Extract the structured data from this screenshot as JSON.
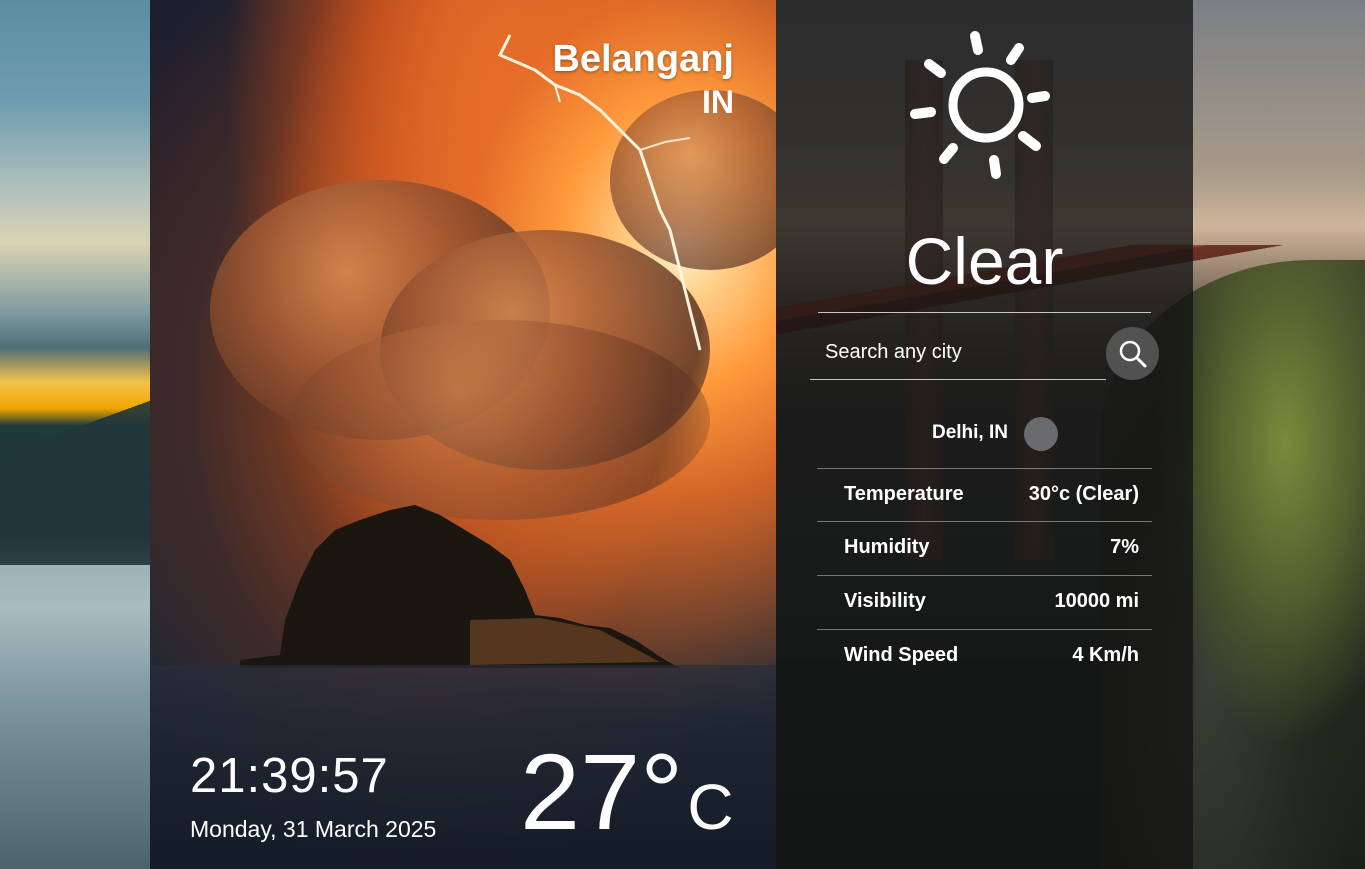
{
  "location": {
    "city": "Belanganj",
    "country": "IN"
  },
  "clock": {
    "time": "21:39:57",
    "date": "Monday, 31 March 2025"
  },
  "current_temp": {
    "value": "27°",
    "unit": "C"
  },
  "panel": {
    "icon": "sun-icon",
    "condition": "Clear",
    "search": {
      "placeholder": "Search any city",
      "button_icon": "search-icon"
    },
    "result": {
      "city": "Delhi, IN"
    },
    "details": [
      {
        "label": "Temperature",
        "value": "30°c (Clear)"
      },
      {
        "label": "Humidity",
        "value": "7%"
      },
      {
        "label": "Visibility",
        "value": "10000 mi"
      },
      {
        "label": "Wind Speed",
        "value": "4 Km/h"
      }
    ]
  },
  "colors": {
    "panel_bg": "#141414",
    "text": "#ffffff",
    "search_button": "#5a5a5a",
    "result_dot": "#6b6b6f"
  }
}
